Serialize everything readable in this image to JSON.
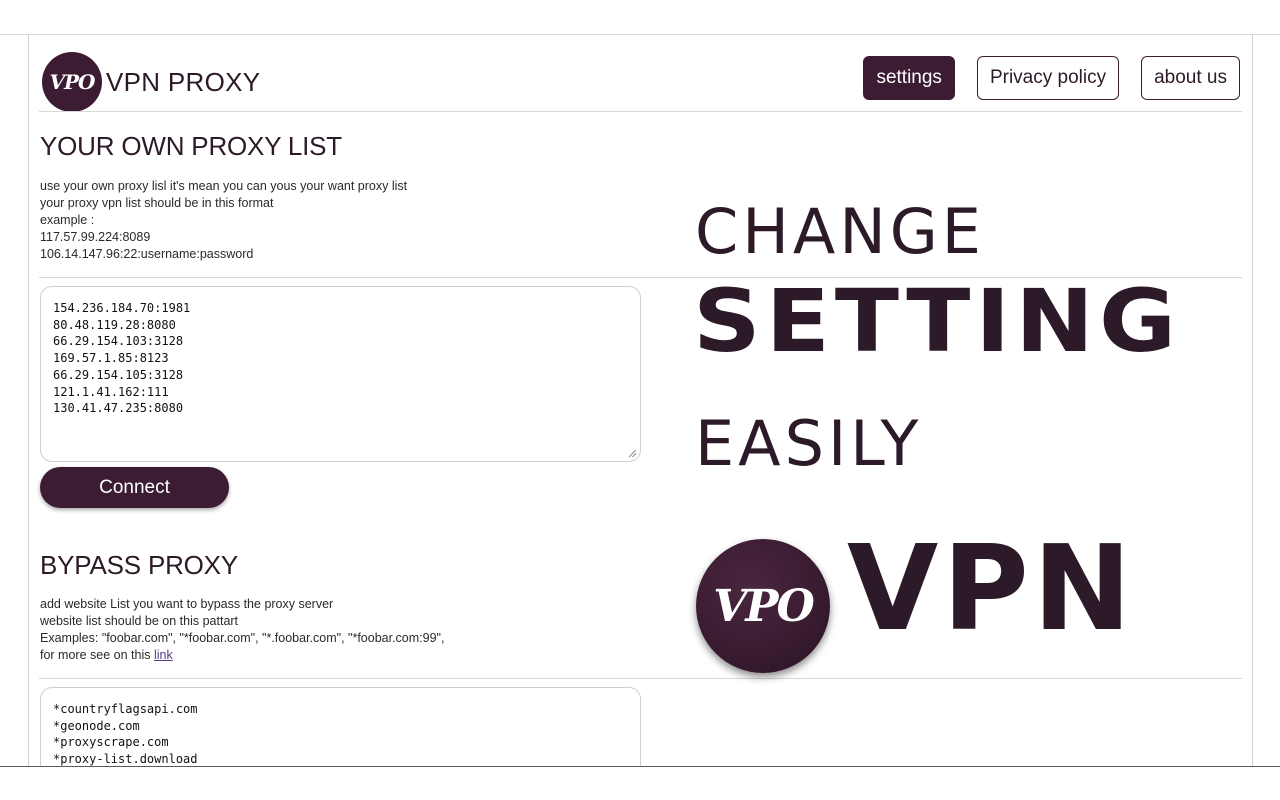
{
  "header": {
    "logo_mark": "VPO",
    "app_name": "VPN PROXY",
    "nav": [
      {
        "label": "settings",
        "active": true
      },
      {
        "label": "Privacy policy",
        "active": false
      },
      {
        "label": "about us",
        "active": false
      }
    ]
  },
  "proxy_list": {
    "title": "YOUR OWN PROXY LIST",
    "desc_lines": [
      "use your own proxy lisl it's mean you can yous your want proxy list",
      "your proxy vpn list should be in this format",
      "example :",
      "117.57.99.224:8089",
      "106.14.147.96:22:username:password"
    ],
    "entries": [
      "154.236.184.70:1981",
      "80.48.119.28:8080",
      "66.29.154.103:3128",
      "169.57.1.85:8123",
      "66.29.154.105:3128",
      "121.1.41.162:111",
      "130.41.47.235:8080"
    ],
    "connect_label": "Connect"
  },
  "bypass": {
    "title": "BYPASS PROXY",
    "desc_lines": [
      "add website List you want to bypass the proxy server",
      "website list should be on this pattart",
      "Examples: \"foobar.com\", \"*foobar.com\", \"*.foobar.com\", \"*foobar.com:99\","
    ],
    "more_prefix": "for more see on this ",
    "more_link": "link",
    "entries": [
      "*countryflagsapi.com",
      "*geonode.com",
      "*proxyscrape.com",
      "*proxy-list.download"
    ]
  },
  "promo": {
    "line1": "CHANGE",
    "line2": "SETTING",
    "line3": "EASILY",
    "logo_mark": "VPO",
    "brand": "VPN"
  },
  "colors": {
    "brand": "#3b1c32",
    "text": "#2d1a28"
  }
}
